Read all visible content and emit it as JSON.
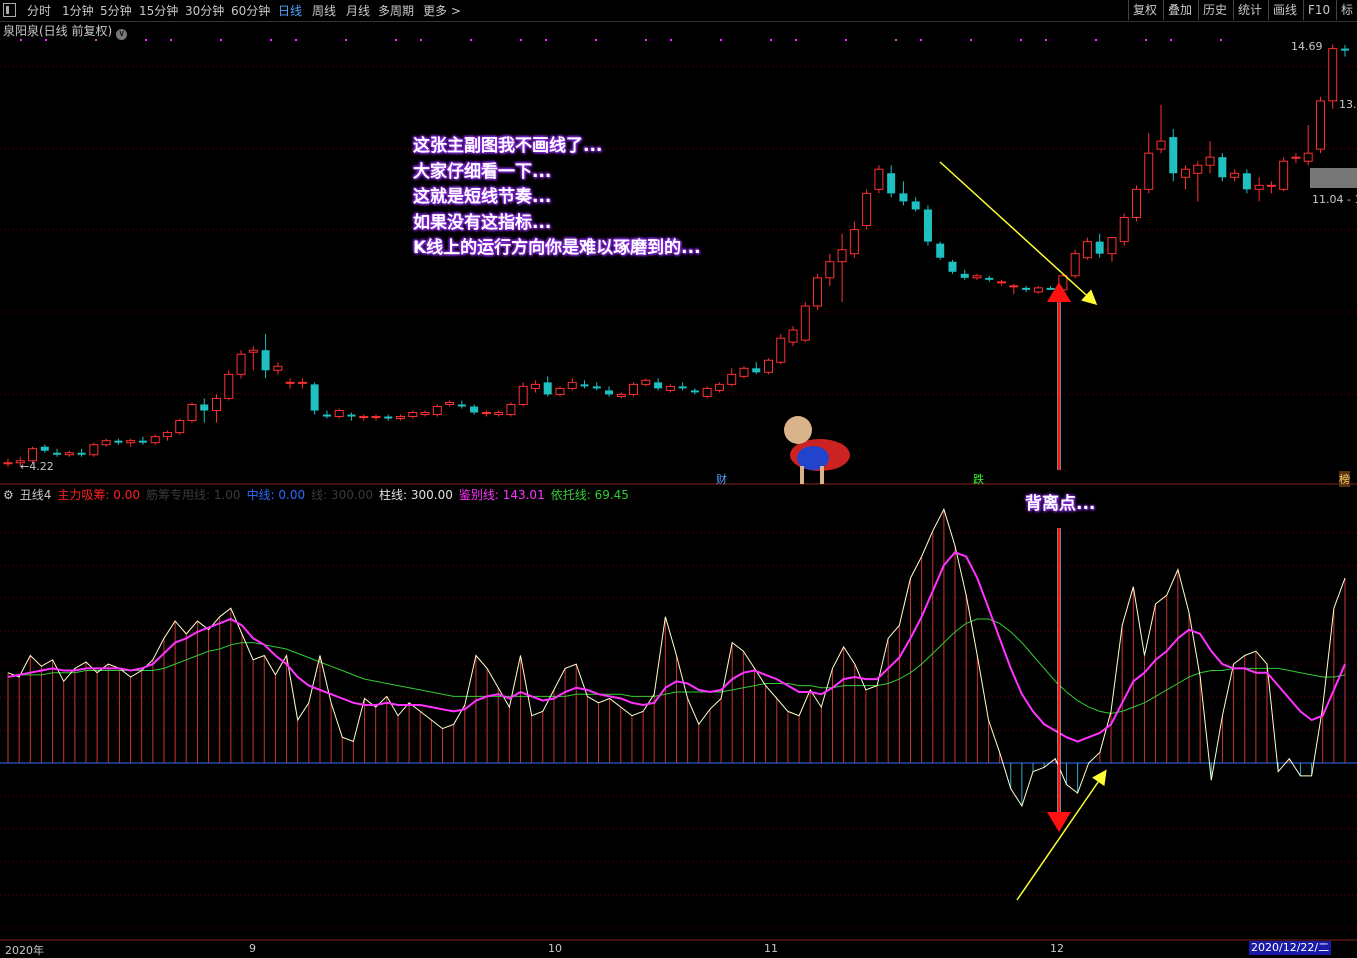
{
  "toolbar": {
    "items": [
      "分时",
      "1分钟",
      "5分钟",
      "15分钟",
      "30分钟",
      "60分钟",
      "日线",
      "周线",
      "月线",
      "多周期",
      "更多 >"
    ],
    "active": "日线",
    "right": [
      "复权",
      "叠加",
      "历史",
      "统计",
      "画线",
      "F10",
      "标"
    ]
  },
  "stock": {
    "title": "泉阳泉(日线 前复权)",
    "circle": "∨"
  },
  "price_labels": {
    "high": "14.69",
    "right_partial": "13.",
    "low": "4.22",
    "box": "11.04 - 1"
  },
  "annotation": [
    "这张主副图我不画线了...",
    "大家仔细看一下...",
    "这就是短线节奏...",
    "如果没有这指标...",
    "K线上的运行方向你是难以琢磨到的..."
  ],
  "divergence_label": "背离点...",
  "badges": {
    "cai": "财",
    "die": "跌",
    "bang": "榜"
  },
  "indicator": {
    "name": "丑线4",
    "items": [
      {
        "label": "主力吸筹: 0.00",
        "color": "#ff2020"
      },
      {
        "label": "筋筹专用线: 1.00",
        "color": "#3a3a3a"
      },
      {
        "label": "中线: 0.00",
        "color": "#2f6bff"
      },
      {
        "label": "线: 300.00",
        "color": "#3a3a3a"
      },
      {
        "label": "柱线: 300.00",
        "color": "#e0e0e0"
      },
      {
        "label": "鉴别线: 143.01",
        "color": "#ff33ff"
      },
      {
        "label": "依托线: 69.45",
        "color": "#33cc33"
      }
    ]
  },
  "xaxis": {
    "labels": [
      "2020年",
      "9",
      "10",
      "11",
      "12"
    ],
    "date": "2020/12/22/二"
  },
  "colors": {
    "up": "#ff3030",
    "down": "#20c0c0",
    "magenta": "#ff33ff",
    "green": "#33cc33",
    "yellow": "#ffff33"
  },
  "chart_data": {
    "type": "candlestick",
    "candles": [
      [
        4.3,
        4.4,
        4.2,
        4.3
      ],
      [
        4.3,
        4.45,
        4.2,
        4.35
      ],
      [
        4.35,
        4.7,
        4.3,
        4.65
      ],
      [
        4.7,
        4.75,
        4.55,
        4.6
      ],
      [
        4.55,
        4.65,
        4.45,
        4.5
      ],
      [
        4.5,
        4.6,
        4.45,
        4.55
      ],
      [
        4.55,
        4.65,
        4.45,
        4.5
      ],
      [
        4.5,
        4.8,
        4.45,
        4.75
      ],
      [
        4.75,
        4.9,
        4.7,
        4.85
      ],
      [
        4.85,
        4.9,
        4.75,
        4.8
      ],
      [
        4.8,
        4.9,
        4.7,
        4.85
      ],
      [
        4.85,
        4.95,
        4.75,
        4.8
      ],
      [
        4.8,
        5.0,
        4.75,
        4.95
      ],
      [
        4.95,
        5.1,
        4.85,
        5.05
      ],
      [
        5.05,
        5.4,
        5.0,
        5.35
      ],
      [
        5.35,
        5.8,
        5.3,
        5.75
      ],
      [
        5.75,
        5.9,
        5.3,
        5.6
      ],
      [
        5.6,
        6.0,
        5.3,
        5.9
      ],
      [
        5.9,
        6.6,
        5.85,
        6.5
      ],
      [
        6.5,
        7.1,
        6.4,
        7.0
      ],
      [
        7.05,
        7.2,
        6.6,
        7.1
      ],
      [
        7.1,
        7.5,
        6.4,
        6.6
      ],
      [
        6.6,
        6.8,
        6.5,
        6.7
      ],
      [
        6.3,
        6.4,
        6.15,
        6.3
      ],
      [
        6.3,
        6.4,
        6.15,
        6.3
      ],
      [
        6.25,
        6.3,
        5.5,
        5.6
      ],
      [
        5.5,
        5.6,
        5.4,
        5.45
      ],
      [
        5.45,
        5.65,
        5.4,
        5.6
      ],
      [
        5.5,
        5.55,
        5.35,
        5.45
      ],
      [
        5.45,
        5.5,
        5.35,
        5.45
      ],
      [
        5.45,
        5.5,
        5.35,
        5.45
      ],
      [
        5.45,
        5.5,
        5.35,
        5.4
      ],
      [
        5.4,
        5.5,
        5.35,
        5.45
      ],
      [
        5.45,
        5.6,
        5.4,
        5.55
      ],
      [
        5.5,
        5.6,
        5.45,
        5.55
      ],
      [
        5.5,
        5.75,
        5.45,
        5.7
      ],
      [
        5.75,
        5.85,
        5.7,
        5.8
      ],
      [
        5.75,
        5.85,
        5.65,
        5.7
      ],
      [
        5.7,
        5.75,
        5.5,
        5.55
      ],
      [
        5.55,
        5.6,
        5.45,
        5.55
      ],
      [
        5.5,
        5.6,
        5.45,
        5.55
      ],
      [
        5.5,
        5.8,
        5.45,
        5.75
      ],
      [
        5.75,
        6.3,
        5.7,
        6.2
      ],
      [
        6.15,
        6.35,
        6.05,
        6.25
      ],
      [
        6.3,
        6.45,
        5.95,
        6.0
      ],
      [
        6.0,
        6.2,
        5.95,
        6.15
      ],
      [
        6.15,
        6.4,
        6.1,
        6.3
      ],
      [
        6.25,
        6.35,
        6.15,
        6.2
      ],
      [
        6.2,
        6.3,
        6.1,
        6.15
      ],
      [
        6.1,
        6.2,
        5.95,
        6.0
      ],
      [
        5.95,
        6.05,
        5.9,
        6.0
      ],
      [
        6.0,
        6.3,
        5.95,
        6.25
      ],
      [
        6.25,
        6.4,
        6.2,
        6.35
      ],
      [
        6.3,
        6.4,
        6.1,
        6.15
      ],
      [
        6.1,
        6.25,
        6.05,
        6.2
      ],
      [
        6.2,
        6.3,
        6.1,
        6.15
      ],
      [
        6.1,
        6.15,
        6.0,
        6.05
      ],
      [
        5.95,
        6.2,
        5.9,
        6.15
      ],
      [
        6.1,
        6.3,
        6.05,
        6.25
      ],
      [
        6.25,
        6.65,
        6.2,
        6.5
      ],
      [
        6.45,
        6.7,
        6.4,
        6.65
      ],
      [
        6.65,
        6.8,
        6.5,
        6.55
      ],
      [
        6.55,
        6.9,
        6.5,
        6.85
      ],
      [
        6.8,
        7.5,
        6.75,
        7.4
      ],
      [
        7.3,
        7.7,
        7.2,
        7.6
      ],
      [
        7.35,
        8.3,
        7.3,
        8.2
      ],
      [
        8.2,
        9.0,
        8.1,
        8.9
      ],
      [
        8.9,
        9.5,
        8.7,
        9.3
      ],
      [
        9.3,
        10.0,
        8.3,
        9.6
      ],
      [
        9.5,
        10.3,
        9.4,
        10.1
      ],
      [
        10.2,
        11.1,
        10.1,
        11.0
      ],
      [
        11.1,
        11.7,
        11.0,
        11.6
      ],
      [
        11.5,
        11.7,
        10.9,
        11.0
      ],
      [
        11.0,
        11.3,
        10.7,
        10.8
      ],
      [
        10.8,
        10.9,
        10.55,
        10.6
      ],
      [
        10.6,
        10.7,
        9.7,
        9.8
      ],
      [
        9.75,
        9.8,
        9.35,
        9.4
      ],
      [
        9.3,
        9.35,
        9.0,
        9.05
      ],
      [
        9.0,
        9.1,
        8.85,
        8.9
      ],
      [
        8.9,
        9.0,
        8.85,
        8.95
      ],
      [
        8.9,
        8.95,
        8.8,
        8.85
      ],
      [
        8.8,
        8.85,
        8.7,
        8.8
      ],
      [
        8.7,
        8.75,
        8.5,
        8.7
      ],
      [
        8.65,
        8.7,
        8.55,
        8.6
      ],
      [
        8.55,
        8.7,
        8.5,
        8.65
      ],
      [
        8.65,
        8.7,
        8.6,
        8.6
      ],
      [
        8.6,
        9.0,
        8.55,
        8.95
      ],
      [
        8.95,
        9.6,
        8.9,
        9.5
      ],
      [
        9.4,
        9.9,
        9.35,
        9.8
      ],
      [
        9.8,
        10.0,
        9.4,
        9.5
      ],
      [
        9.5,
        9.9,
        9.3,
        9.9
      ],
      [
        9.8,
        10.5,
        9.7,
        10.4
      ],
      [
        10.4,
        11.2,
        10.3,
        11.1
      ],
      [
        11.1,
        12.5,
        11.0,
        12.0
      ],
      [
        12.1,
        13.2,
        12.0,
        12.3
      ],
      [
        12.4,
        12.6,
        11.3,
        11.5
      ],
      [
        11.4,
        11.7,
        11.1,
        11.6
      ],
      [
        11.5,
        11.8,
        10.8,
        11.7
      ],
      [
        11.7,
        12.3,
        11.5,
        11.9
      ],
      [
        11.9,
        12.0,
        11.3,
        11.4
      ],
      [
        11.4,
        11.6,
        11.3,
        11.5
      ],
      [
        11.5,
        11.6,
        11.0,
        11.1
      ],
      [
        11.1,
        11.4,
        10.8,
        11.2
      ],
      [
        11.2,
        11.3,
        11.0,
        11.2
      ],
      [
        11.1,
        11.9,
        11.05,
        11.8
      ],
      [
        11.9,
        12.0,
        11.75,
        11.9
      ],
      [
        11.8,
        12.7,
        11.7,
        12.0
      ],
      [
        12.1,
        13.4,
        12.0,
        13.3
      ],
      [
        13.3,
        14.7,
        13.1,
        14.6
      ],
      [
        14.6,
        14.69,
        14.4,
        14.55
      ]
    ],
    "osc_yellow": [
      42,
      40,
      50,
      45,
      48,
      38,
      44,
      47,
      42,
      46,
      44,
      40,
      43,
      48,
      58,
      66,
      60,
      66,
      62,
      68,
      72,
      60,
      48,
      50,
      41,
      50,
      20,
      28,
      50,
      28,
      12,
      10,
      30,
      26,
      31,
      22,
      28,
      24,
      20,
      16,
      18,
      27,
      50,
      44,
      35,
      26,
      50,
      22,
      24,
      34,
      44,
      46,
      31,
      28,
      30,
      26,
      22,
      24,
      32,
      68,
      50,
      30,
      18,
      25,
      30,
      56,
      52,
      44,
      36,
      30,
      24,
      22,
      34,
      26,
      44,
      54,
      46,
      34,
      36,
      58,
      64,
      86,
      96,
      108,
      118,
      101,
      78,
      50,
      20,
      5,
      -12,
      -20,
      -4,
      -2,
      2,
      -10,
      -14,
      0,
      5,
      24,
      64,
      82,
      50,
      74,
      78,
      90,
      70,
      40,
      -8,
      22,
      46,
      50,
      52,
      46,
      -4,
      2,
      -6,
      -6,
      26,
      72,
      86
    ],
    "osc_magenta": [
      40,
      41,
      42,
      43,
      44,
      43,
      43,
      44,
      44,
      44,
      44,
      43,
      44,
      46,
      51,
      56,
      58,
      61,
      63,
      65,
      67,
      64,
      58,
      55,
      50,
      46,
      40,
      36,
      34,
      32,
      30,
      28,
      27,
      27,
      28,
      27,
      27,
      27,
      26,
      25,
      24,
      25,
      29,
      31,
      32,
      30,
      33,
      31,
      29,
      30,
      33,
      35,
      34,
      32,
      31,
      30,
      28,
      27,
      28,
      35,
      38,
      37,
      34,
      33,
      34,
      39,
      42,
      43,
      41,
      39,
      36,
      33,
      33,
      32,
      35,
      39,
      40,
      39,
      39,
      44,
      49,
      58,
      68,
      80,
      92,
      98,
      96,
      86,
      72,
      58,
      44,
      32,
      24,
      18,
      15,
      12,
      10,
      12,
      14,
      18,
      28,
      38,
      42,
      48,
      52,
      58,
      62,
      60,
      52,
      46,
      44,
      44,
      42,
      42,
      36,
      30,
      24,
      20,
      22,
      34,
      46
    ],
    "osc_green": [
      40,
      41,
      41,
      41,
      42,
      42,
      42,
      43,
      43,
      43,
      43,
      43,
      43,
      43,
      44,
      46,
      48,
      50,
      52,
      53,
      55,
      56,
      56,
      55,
      54,
      53,
      51,
      49,
      47,
      45,
      43,
      41,
      39,
      38,
      37,
      36,
      35,
      34,
      33,
      32,
      31,
      31,
      31,
      31,
      31,
      31,
      31,
      31,
      31,
      31,
      31,
      32,
      32,
      32,
      32,
      32,
      31,
      31,
      31,
      32,
      33,
      33,
      33,
      33,
      33,
      34,
      35,
      36,
      37,
      37,
      37,
      36,
      36,
      35,
      35,
      36,
      36,
      36,
      36,
      37,
      39,
      42,
      46,
      51,
      56,
      61,
      65,
      67,
      67,
      65,
      61,
      56,
      50,
      44,
      38,
      33,
      29,
      26,
      24,
      23,
      24,
      26,
      28,
      31,
      34,
      37,
      40,
      42,
      43,
      43,
      44,
      44,
      44,
      44,
      44,
      43,
      42,
      41,
      40,
      40,
      41
    ],
    "osc_range": [
      -30,
      120
    ]
  }
}
